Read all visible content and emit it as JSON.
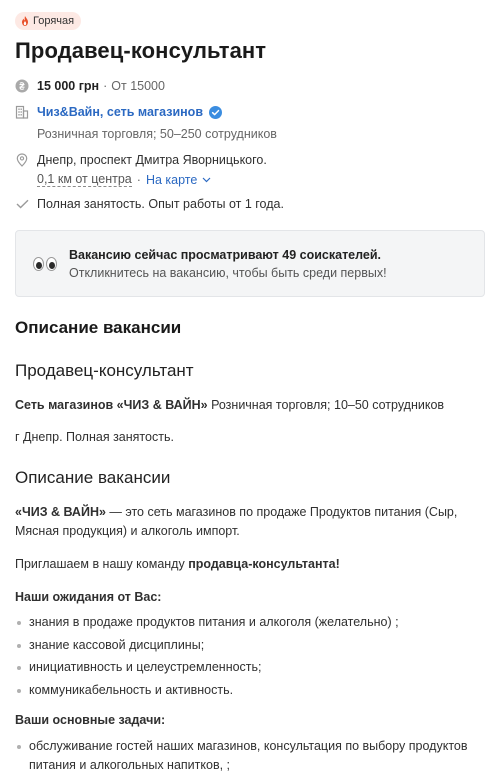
{
  "badge": {
    "label": "Горячая",
    "color": "#e8502a"
  },
  "title": "Продавец-консультант",
  "salary": {
    "amount": "15 000 грн",
    "separator": "·",
    "range": "От 15000"
  },
  "company": {
    "name": "Чиз&Вайн, сеть магазинов",
    "verified": true,
    "meta": "Розничная торговля; 50–250 сотрудников"
  },
  "location": {
    "address": "Днепр, проспект Дмитра Яворницького.",
    "distance": "0,1 км от центра",
    "separator": "·",
    "map_link": "На карте"
  },
  "employment": "Полная занятость. Опыт работы от 1 года.",
  "notice": {
    "title": "Вакансию сейчас просматривают 49 соискателей.",
    "subtitle": "Откликнитесь на вакансию, чтобы быть среди первых!"
  },
  "description": {
    "heading": "Описание вакансии",
    "job_title": "Продавец-консультант",
    "company_line_bold": "Сеть магазинов «ЧИЗ & ВАЙН»",
    "company_line_rest": " Розничная торговля; 10–50 сотрудников",
    "location_line": "г Днепр. Полная занятость.",
    "section2_title": "Описание вакансии",
    "about_bold": "«ЧИЗ & ВАЙН»",
    "about_rest": " — это сеть магазинов по продаже Продуктов питания (Сыр, Мясная продукция) и алкоголь импорт.",
    "invite_prefix": "Приглашаем в нашу команду ",
    "invite_bold": "продавца-консультанта!",
    "expectations_title": "Наши ожидания от Вас:",
    "expectations": [
      "знания в продаже продуктов питания и алкоголя (желательно) ;",
      "знание кассовой дисциплины;",
      "инициативность и целеустремленность;",
      "коммуникабельность и активность."
    ],
    "tasks_title": "Ваши основные задачи:",
    "tasks": [
      "обслуживание гостей наших магазинов, консультация по выбору продуктов питания и алкогольных напитков, ;"
    ]
  },
  "colors": {
    "accent": "#2b69c2",
    "verified": "#3b8de0",
    "hot_bg": "#fde9e4"
  }
}
